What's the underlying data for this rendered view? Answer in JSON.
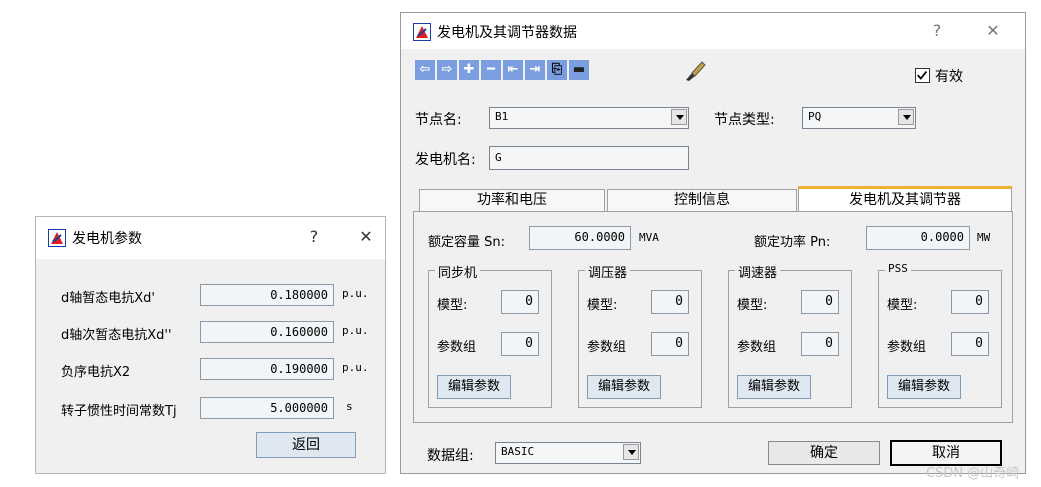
{
  "left_window": {
    "title": "发电机参数",
    "help_icon": "?",
    "close_icon": "✕",
    "rows": [
      {
        "label": "d轴暂态电抗Xd'",
        "value": "0.180000",
        "unit": "p.u."
      },
      {
        "label": "d轴次暂态电抗Xd''",
        "value": "0.160000",
        "unit": "p.u."
      },
      {
        "label": "负序电抗X2",
        "value": "0.190000",
        "unit": "p.u."
      },
      {
        "label": "转子惯性时间常数Tj",
        "value": "5.000000",
        "unit": "s"
      }
    ],
    "return_label": "返回"
  },
  "right_window": {
    "title": "发电机及其调节器数据",
    "help_icon": "?",
    "close_icon": "✕",
    "toolbar": {
      "icons": [
        "arrow-left-icon",
        "arrow-right-icon",
        "plus-icon",
        "minus-icon",
        "first-icon",
        "last-icon",
        "copy-icon",
        "paste-icon",
        "brush-icon"
      ]
    },
    "valid_label": "有效",
    "valid_checked": true,
    "node_name_label": "节点名:",
    "node_name_value": "B1",
    "node_type_label": "节点类型:",
    "node_type_value": "PQ",
    "gen_name_label": "发电机名:",
    "gen_name_value": "G",
    "tabs": [
      {
        "label": "功率和电压",
        "active": false
      },
      {
        "label": "控制信息",
        "active": false
      },
      {
        "label": "发电机及其调节器",
        "active": true
      }
    ],
    "rated_capacity_label": "额定容量 Sn:",
    "rated_capacity_value": "60.0000",
    "rated_capacity_unit": "MVA",
    "rated_power_label": "额定功率 Pn:",
    "rated_power_value": "0.0000",
    "rated_power_unit": "MW",
    "groups": [
      {
        "title": "同步机",
        "model_label": "模型:",
        "model_value": "0",
        "param_label": "参数组",
        "param_value": "0",
        "edit_label": "编辑参数"
      },
      {
        "title": "调压器",
        "model_label": "模型:",
        "model_value": "0",
        "param_label": "参数组",
        "param_value": "0",
        "edit_label": "编辑参数"
      },
      {
        "title": "调速器",
        "model_label": "模型:",
        "model_value": "0",
        "param_label": "参数组",
        "param_value": "0",
        "edit_label": "编辑参数"
      },
      {
        "title": "PSS",
        "model_label": "模型:",
        "model_value": "0",
        "param_label": "参数组",
        "param_value": "0",
        "edit_label": "编辑参数"
      }
    ],
    "dataset_label": "数据组:",
    "dataset_value": "BASIC",
    "ok_label": "确定",
    "cancel_label": "取消"
  },
  "watermark": "CSDN @山奇崎"
}
